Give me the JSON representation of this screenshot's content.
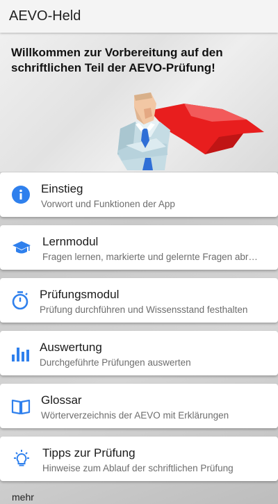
{
  "app": {
    "title": "AEVO-Held"
  },
  "hero": {
    "welcome": "Willkommen zur Vorbereitung auf den schriftlichen Teil der AEVO-Prüfung!"
  },
  "menu": [
    {
      "title": "Einstieg",
      "subtitle": "Vorwort und Funktionen der App",
      "icon": "info-icon"
    },
    {
      "title": "Lernmodul",
      "subtitle": "Fragen lernen, markierte und gelernte Fragen abr…",
      "icon": "graduation-cap-icon"
    },
    {
      "title": "Prüfungsmodul",
      "subtitle": "Prüfung durchführen und Wissensstand festhalten",
      "icon": "stopwatch-icon"
    },
    {
      "title": "Auswertung",
      "subtitle": "Durchgeführte Prüfungen auswerten",
      "icon": "bar-chart-icon"
    },
    {
      "title": "Glossar",
      "subtitle": "Wörterverzeichnis der AEVO mit Erklärungen",
      "icon": "book-icon"
    },
    {
      "title": "Tipps zur Prüfung",
      "subtitle": "Hinweise zum Ablauf der schriftlichen Prüfung",
      "icon": "lightbulb-icon"
    }
  ],
  "footer": {
    "more_label": "mehr"
  },
  "colors": {
    "accent": "#2f80ed",
    "cape": "#e81e1e"
  }
}
